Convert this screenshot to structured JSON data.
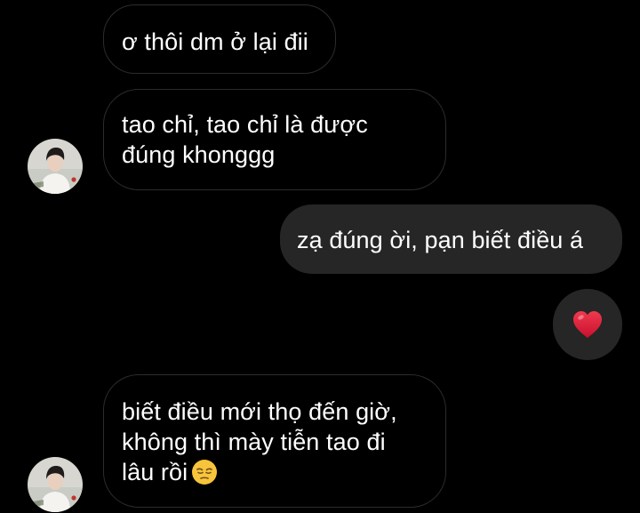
{
  "messages": [
    {
      "id": "msg1",
      "sender": "other",
      "lines": [
        "ơ thôi dm ở lại đii"
      ]
    },
    {
      "id": "msg2",
      "sender": "other",
      "lines": [
        "tao chỉ, tao chỉ là được",
        "đúng khonggg"
      ]
    },
    {
      "id": "msg3",
      "sender": "me",
      "lines": [
        "zạ đúng ời, pạn biết điều á"
      ]
    },
    {
      "id": "msg4",
      "sender": "me",
      "reaction": "❤️",
      "icon": "red-heart-icon"
    },
    {
      "id": "msg5",
      "sender": "other",
      "lines": [
        "biết điều mới thọ đến giờ,",
        "không thì mày tiễn tao đi",
        "lâu rồi"
      ],
      "emoji": "😔",
      "emoji_icon": "pensive-face-icon"
    }
  ],
  "colors": {
    "background": "#000000",
    "incoming_border": "#2c2c2e",
    "outgoing_bubble": "#262626",
    "text": "#ffffff",
    "heart": "#e0203a"
  }
}
